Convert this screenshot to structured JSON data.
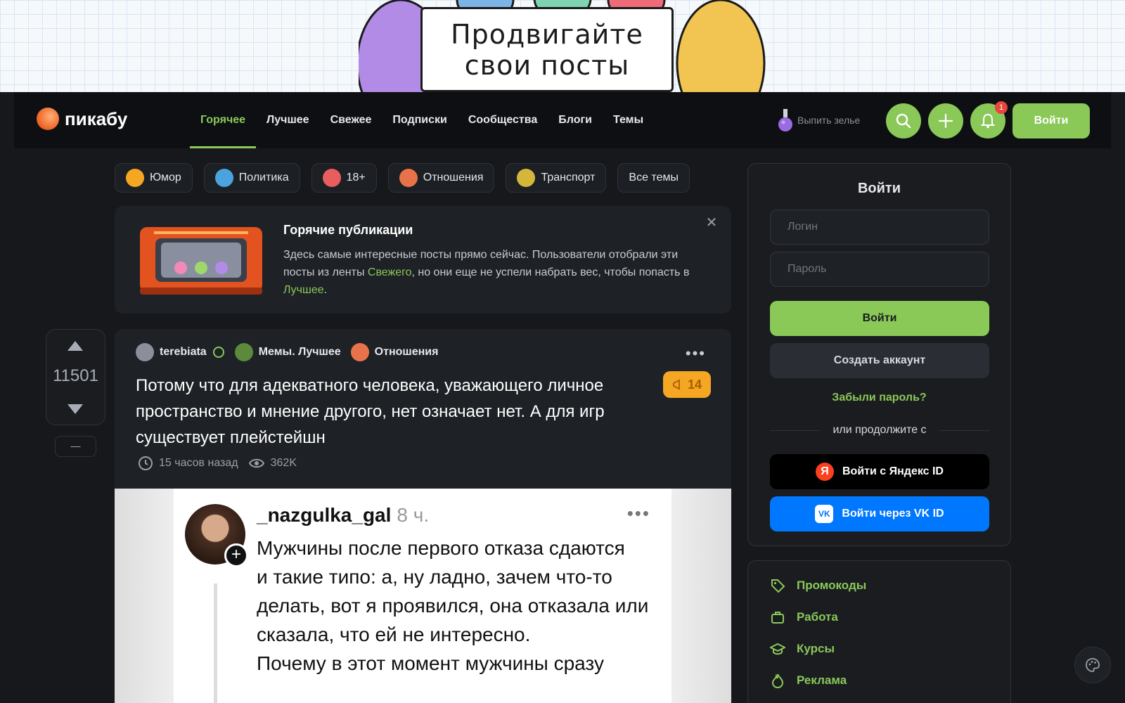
{
  "banner": {
    "line1": "Продвигайте",
    "line2": "свои посты"
  },
  "header": {
    "logo": "пикабу",
    "nav": [
      "Горячее",
      "Лучшее",
      "Свежее",
      "Подписки",
      "Сообщества",
      "Блоги",
      "Темы"
    ],
    "active_nav": "Горячее",
    "potion": "Выпить зелье",
    "notification_count": "1",
    "login": "Войти"
  },
  "chips": [
    {
      "label": "Юмор",
      "color": "#f5a623"
    },
    {
      "label": "Политика",
      "color": "#4aa3df"
    },
    {
      "label": "18+",
      "color": "#e85d5d"
    },
    {
      "label": "Отношения",
      "color": "#e8734a"
    },
    {
      "label": "Транспорт",
      "color": "#d4b73a"
    },
    {
      "label": "Все темы",
      "color": ""
    }
  ],
  "hot": {
    "title": "Горячие публикации",
    "text_a": "Здесь самые интересные посты прямо сейчас. Пользователи отобрали эти посты из ленты ",
    "link_fresh": "Свежего",
    "text_b": ", но они еще не успели набрать вес, чтобы попасть в ",
    "link_best": "Лучшее",
    "text_c": "."
  },
  "vote": {
    "count": "11501",
    "minus": "—"
  },
  "post": {
    "author": "terebiata",
    "community": "Мемы. Лучшее",
    "tag": "Отношения",
    "title": "Потому что для адекватного человека, уважающего личное пространство и мнение другого, нет означает нет. А для игр существует плейстейшн",
    "promo": "14",
    "time": "15 часов назад",
    "views": "362K",
    "image": {
      "user": "_nazgulka_gal",
      "time": "8 ч.",
      "text": "Мужчины после первого отказа сдаются\nи такие типо: а, ну ладно, зачем что-то делать, вот я проявился, она отказала или сказала, что ей не интересно.\nПочему в этот момент мужчины сразу"
    }
  },
  "login_panel": {
    "title": "Войти",
    "login_placeholder": "Логин",
    "password_placeholder": "Пароль",
    "submit": "Войти",
    "create": "Создать аккаунт",
    "forgot": "Забыли пароль?",
    "or": "или продолжите с",
    "yandex": "Войти с Яндекс ID",
    "vk": "Войти через VK ID"
  },
  "links": [
    "Промокоды",
    "Работа",
    "Курсы",
    "Реклама"
  ],
  "colors": {
    "accent": "#8ac858",
    "bg": "#16181c",
    "panel": "#1a1c20",
    "promo": "#f5a623"
  }
}
